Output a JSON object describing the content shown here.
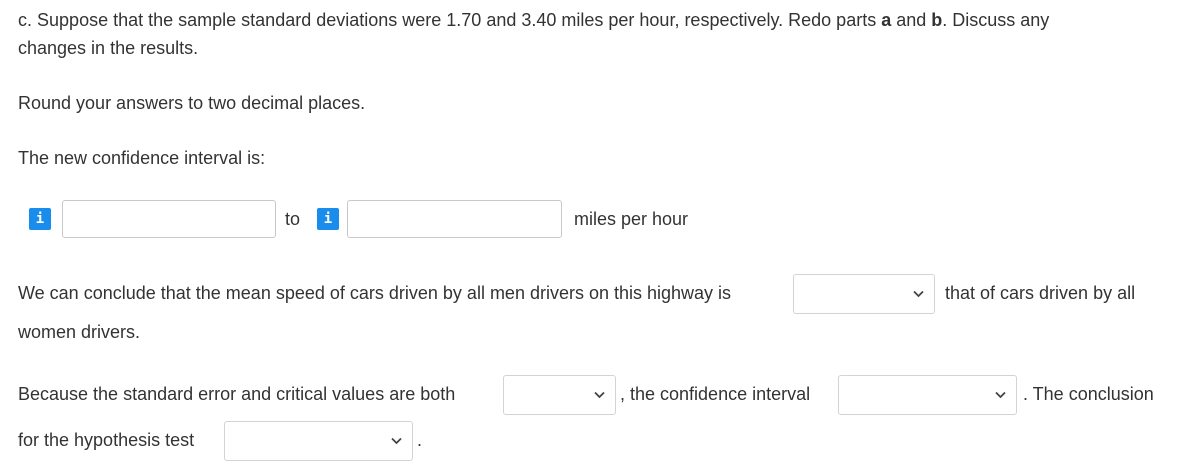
{
  "question": {
    "part_label": "c.",
    "line1_pre": "Suppose that the sample standard deviations were 1.70 and 3.40 miles per hour, respectively. Redo parts ",
    "part_a": "a",
    "line1_and": " and ",
    "part_b": "b",
    "line1_post": ". Discuss any",
    "line2": "changes in the results."
  },
  "instructions": "Round your answers to two decimal places.",
  "ci_label": "The new confidence interval is:",
  "ci": {
    "info_icon_glyph": "i",
    "lower_value": "",
    "to_label": "to",
    "upper_value": "",
    "unit": "miles per hour"
  },
  "conclusion": {
    "text_pre": "We can conclude that the mean speed of cars driven by all men drivers on this highway is",
    "select_value": "",
    "text_post": "that of cars driven by all",
    "text_line2": "women drivers."
  },
  "because": {
    "text_pre": "Because the standard error and critical values are both",
    "select1_value": "",
    "text_mid": ", the confidence interval",
    "select2_value": "",
    "text_post": ". The conclusion",
    "line2_pre": "for the hypothesis test",
    "select3_value": "",
    "line2_post": "."
  },
  "colors": {
    "info_button": "#1a8ceb",
    "text": "#333333",
    "border": "#c9c9c9"
  }
}
